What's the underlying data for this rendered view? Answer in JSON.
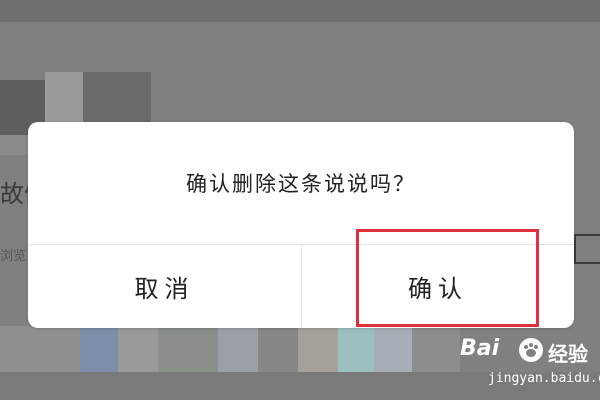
{
  "dialog": {
    "message": "确认删除这条说说吗？",
    "cancel_label": "取消",
    "confirm_label": "确认"
  },
  "background": {
    "left_text": "故催",
    "left_subtext": "浏览"
  },
  "colors": {
    "overlay": "#808080",
    "dialog_bg": "#ffffff",
    "highlight": "#e0303a"
  },
  "watermark": {
    "brand": "Bai",
    "brand_suffix": "经验",
    "url": "jingyan.baidu.com"
  }
}
